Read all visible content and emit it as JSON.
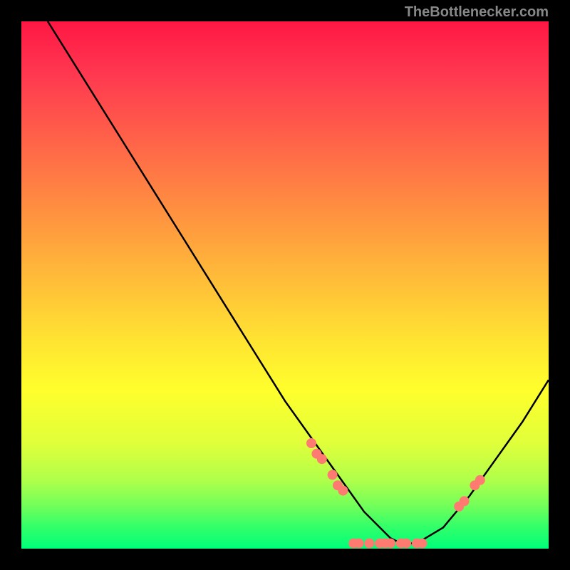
{
  "attribution": "TheBottlenecker.com",
  "chart_data": {
    "type": "line",
    "title": "",
    "xlabel": "",
    "ylabel": "",
    "xlim": [
      0,
      100
    ],
    "ylim": [
      0,
      100
    ],
    "curve": {
      "x": [
        5,
        10,
        15,
        20,
        25,
        30,
        35,
        40,
        45,
        50,
        55,
        60,
        65,
        70,
        72,
        75,
        80,
        85,
        90,
        95,
        100
      ],
      "y": [
        100,
        92,
        84,
        76,
        68,
        60,
        52,
        44,
        36,
        28,
        21,
        14,
        7,
        2,
        1,
        1,
        4,
        10,
        17,
        24,
        32
      ]
    },
    "scatter_points": [
      {
        "x": 55,
        "y": 20
      },
      {
        "x": 56,
        "y": 18
      },
      {
        "x": 57,
        "y": 17
      },
      {
        "x": 59,
        "y": 14
      },
      {
        "x": 60,
        "y": 12
      },
      {
        "x": 61,
        "y": 11
      },
      {
        "x": 63,
        "y": 1
      },
      {
        "x": 64,
        "y": 1
      },
      {
        "x": 66,
        "y": 1
      },
      {
        "x": 68,
        "y": 1
      },
      {
        "x": 69,
        "y": 1
      },
      {
        "x": 70,
        "y": 1
      },
      {
        "x": 72,
        "y": 1
      },
      {
        "x": 73,
        "y": 1
      },
      {
        "x": 75,
        "y": 1
      },
      {
        "x": 76,
        "y": 1
      },
      {
        "x": 83,
        "y": 8
      },
      {
        "x": 84,
        "y": 9
      },
      {
        "x": 86,
        "y": 12
      },
      {
        "x": 87,
        "y": 13
      }
    ]
  }
}
